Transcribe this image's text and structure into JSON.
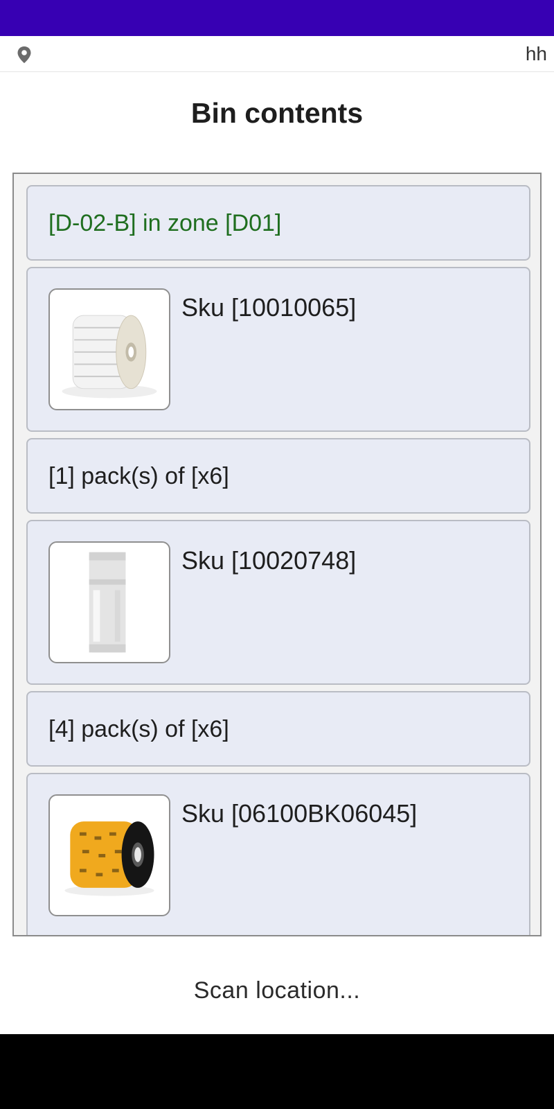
{
  "header": {
    "location_icon": "location-pin-icon",
    "user": "hh"
  },
  "page": {
    "title": "Bin contents"
  },
  "bin": {
    "location": "[D-02-B] in zone [D01]"
  },
  "items": [
    {
      "sku": "Sku [10010065]",
      "packs": "[1] pack(s) of [x6]",
      "image": "label-roll-image"
    },
    {
      "sku": "Sku [10020748]",
      "packs": "[4] pack(s) of [x6]",
      "image": "clear-label-roll-image"
    },
    {
      "sku": "Sku [06100BK06045]",
      "image": "ribbon-roll-image"
    }
  ],
  "footer": {
    "scan_prompt": "Scan location..."
  },
  "colors": {
    "status_bar": "#3700b3",
    "card_bg": "#e8ebf5",
    "zone_text": "#1f6e1f"
  }
}
